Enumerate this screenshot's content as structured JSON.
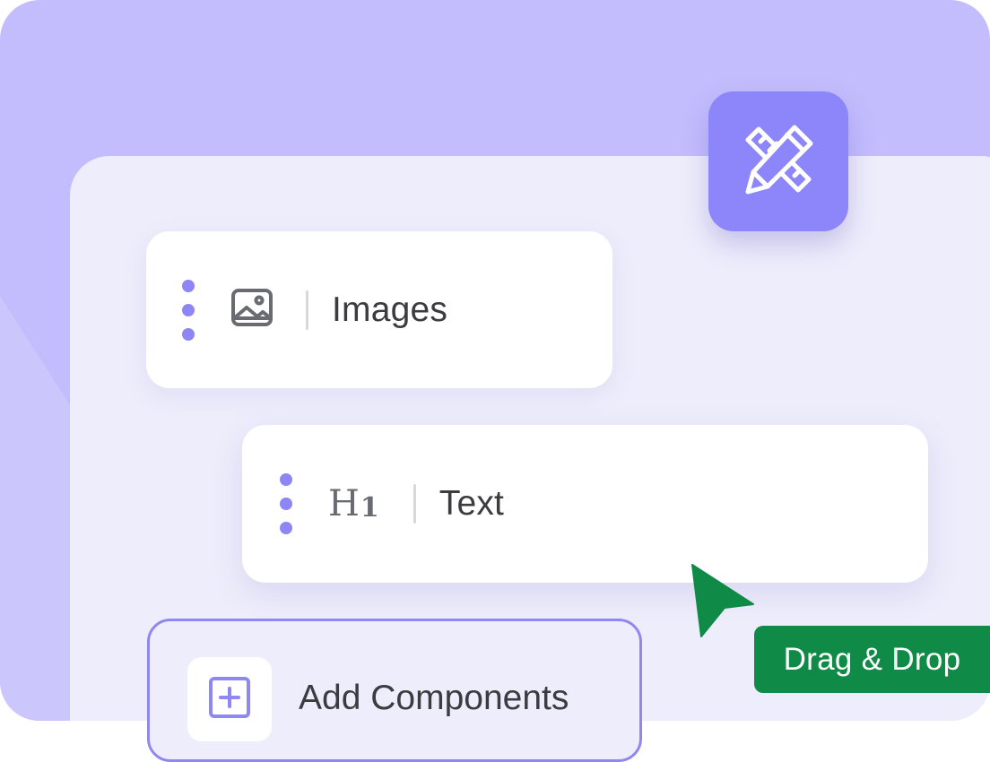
{
  "colors": {
    "background": "#c3bdfd",
    "panel": "#eeedfb",
    "accent": "#8d86fa",
    "dot": "#8e86f5",
    "drag_badge": "#0f8a47",
    "cursor": "#0f8a47"
  },
  "tool_badge": {
    "icon": "pencil-ruler-icon"
  },
  "components": [
    {
      "icon": "image-icon",
      "label": "Images"
    },
    {
      "icon": "heading-h1-icon",
      "icon_text": "H",
      "icon_sub": "1",
      "label": "Text"
    }
  ],
  "add_component": {
    "icon": "plus-square-icon",
    "label": "Add Components"
  },
  "drag_hint": {
    "icon": "cursor-arrow-icon",
    "label": "Drag & Drop"
  }
}
